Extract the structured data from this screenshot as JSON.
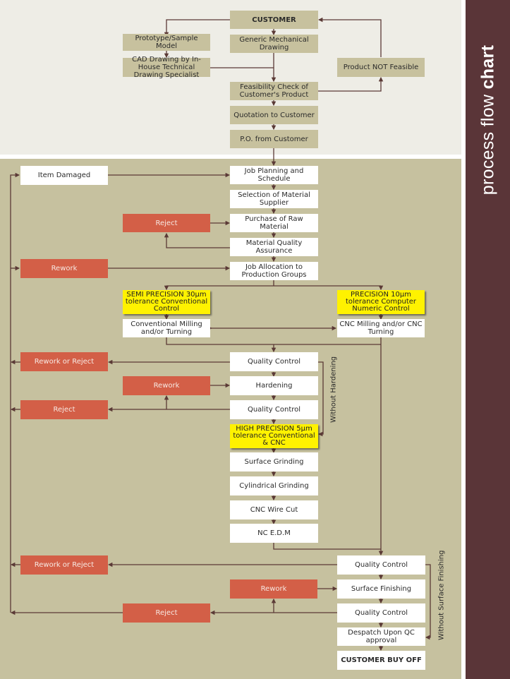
{
  "title": {
    "light": "process flow ",
    "bold": "chart"
  },
  "colors": {
    "top_background": "#eeede6",
    "bottom_background": "#c6c19f",
    "sidebar": "#5a3538",
    "connector": "#5b3a36",
    "reject_box": "#d35f47",
    "highlight_box": "#fff200"
  },
  "nodes": {
    "customer": "CUSTOMER",
    "generic_drawing": "Generic Mechanical Drawing",
    "prototype": "Prototype/Sample Model",
    "cad_drawing": "CAD Drawing by In-House Technical Drawing Specialist",
    "not_feasible": "Product NOT Feasible",
    "feasibility": "Feasibility Check of Customer's Product",
    "quotation": "Quotation to Customer",
    "po": "P.O. from Customer",
    "item_damaged": "Item Damaged",
    "job_planning": "Job Planning and Schedule",
    "material_supplier": "Selection of Material Supplier",
    "reject_material": "Reject",
    "purchase_material": "Purchase of Raw Material",
    "material_qa": "Material Quality Assurance",
    "rework_allocation": "Rework",
    "job_allocation": "Job Allocation to Production Groups",
    "semi_precision": "SEMI PRECISION 30µm tolerance Conventional Control",
    "precision": "PRECISION 10µm tolerance Computer Numeric Control",
    "conventional_milling": "Conventional Milling and/or Turning",
    "cnc_milling": "CNC Milling and/or CNC Turning",
    "rework_or_reject_1": "Rework or Reject",
    "quality_control_1": "Quality Control",
    "rework_hardening": "Rework",
    "hardening": "Hardening",
    "reject_qc2": "Reject",
    "quality_control_2": "Quality Control",
    "high_precision": "HIGH PRECISION 5µm tolerance Conventional & CNC",
    "surface_grinding": "Surface Grinding",
    "cylindrical_grinding": "Cylindrical Grinding",
    "cnc_wire_cut": "CNC Wire Cut",
    "nc_edm": "NC E.D.M",
    "rework_or_reject_2": "Rework or Reject",
    "quality_control_3": "Quality Control",
    "rework_finishing": "Rework",
    "surface_finishing": "Surface Finishing",
    "reject_qc4": "Reject",
    "quality_control_4": "Quality Control",
    "despatch": "Despatch Upon QC approval",
    "buy_off": "CUSTOMER BUY OFF"
  },
  "labels": {
    "without_hardening": "Without Hardening",
    "without_surface_finishing": "Without Surface Finishing"
  }
}
